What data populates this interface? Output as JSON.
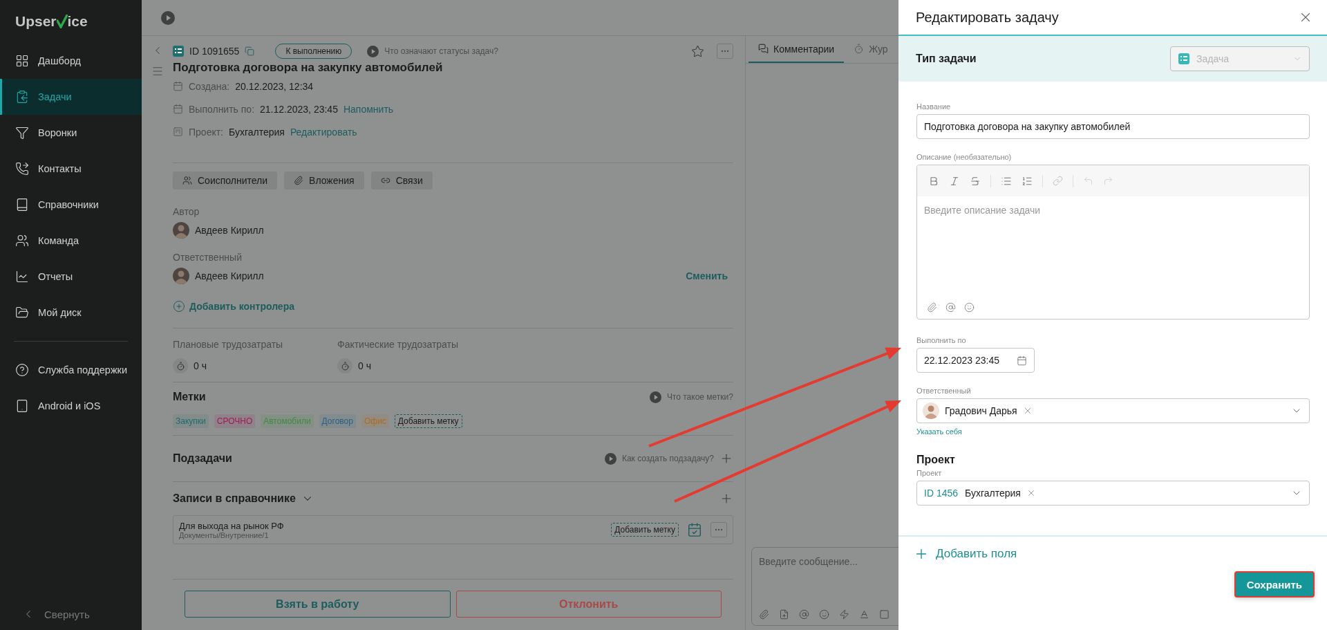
{
  "sidebar": {
    "logo_start": "Upser",
    "logo_end": "ice",
    "items": [
      {
        "label": "Дашборд",
        "selected": false
      },
      {
        "label": "Задачи",
        "selected": true
      },
      {
        "label": "Воронки",
        "selected": false
      },
      {
        "label": "Контакты",
        "selected": false
      },
      {
        "label": "Справочники",
        "selected": false
      },
      {
        "label": "Команда",
        "selected": false
      },
      {
        "label": "Отчеты",
        "selected": false
      },
      {
        "label": "Мой диск",
        "selected": false
      }
    ],
    "support_items": [
      {
        "label": "Служба поддержки",
        "selected": false
      },
      {
        "label": "Android и iOS",
        "selected": false
      }
    ],
    "collapse": "Свернуть"
  },
  "task": {
    "id": "ID 1091655",
    "status": "К выполнению",
    "status_help": "Что означают статусы задач?",
    "title": "Подготовка договора на закупку автомобилей",
    "created_label": "Создана:",
    "created": "20.12.2023, 12:34",
    "due_label": "Выполнить по:",
    "due": "21.12.2023, 23:45",
    "remind": "Напомнить",
    "project_label": "Проект:",
    "project": "Бухгалтерия",
    "edit": "Редактировать",
    "section_buttons": [
      "Соисполнители",
      "Вложения",
      "Связи"
    ],
    "author_label": "Автор",
    "author": "Авдеев Кирилл",
    "assignee_label": "Ответственный",
    "assignee": "Авдеев Кирилл",
    "change": "Сменить",
    "add_controller": "Добавить контролера",
    "efforts": [
      {
        "label": "Плановые трудозатраты",
        "value": "0 ч"
      },
      {
        "label": "Фактические трудозатраты",
        "value": "0 ч"
      }
    ],
    "tags_title": "Метки",
    "tags_help": "Что такое метки?",
    "tags": [
      {
        "label": "Закупки",
        "color": "#1f6b6b"
      },
      {
        "label": "СРОЧНО",
        "color": "#a0195a"
      },
      {
        "label": "Автомобили",
        "color": "#3d8a3f"
      },
      {
        "label": "Договор",
        "color": "#2b5f86"
      },
      {
        "label": "Офис",
        "color": "#b06a1f"
      }
    ],
    "add_tag": "Добавить метку",
    "subtasks_title": "Подзадачи",
    "subtasks_help": "Как создать подзадачу?",
    "records_title": "Записи в справочнике",
    "records": [
      {
        "title": "Для выхода на рынок РФ",
        "path": "Документы/Внутренние/1",
        "add_tag": "Добавить метку"
      }
    ],
    "actions": [
      {
        "label": "Взять в работу",
        "kind": "primary"
      },
      {
        "label": "Отклонить",
        "kind": "danger"
      }
    ]
  },
  "comments": {
    "tabs": [
      {
        "label": "Комментарии",
        "selected": true
      },
      {
        "label": "Жур",
        "selected": false
      }
    ],
    "placeholder": "Введите сообщение..."
  },
  "modal": {
    "title": "Редактировать задачу",
    "type_label": "Тип задачи",
    "type_value": "Задача",
    "type_disabled": true,
    "name_label": "Название",
    "name_value": "Подготовка договора на закупку автомобилей",
    "description_label": "Описание (необязательно)",
    "description_placeholder": "Введите описание задачи",
    "due_label": "Выполнить по",
    "due_value": "22.12.2023 23:45",
    "assignee_label": "Ответственный",
    "assignee": "Градович Дарья",
    "assign_self": "Указать себя",
    "project_heading": "Проект",
    "project_label": "Проект",
    "project_id": "ID 1456",
    "project_name": "Бухгалтерия",
    "add_fields": "Добавить поля",
    "save": "Сохранить"
  }
}
